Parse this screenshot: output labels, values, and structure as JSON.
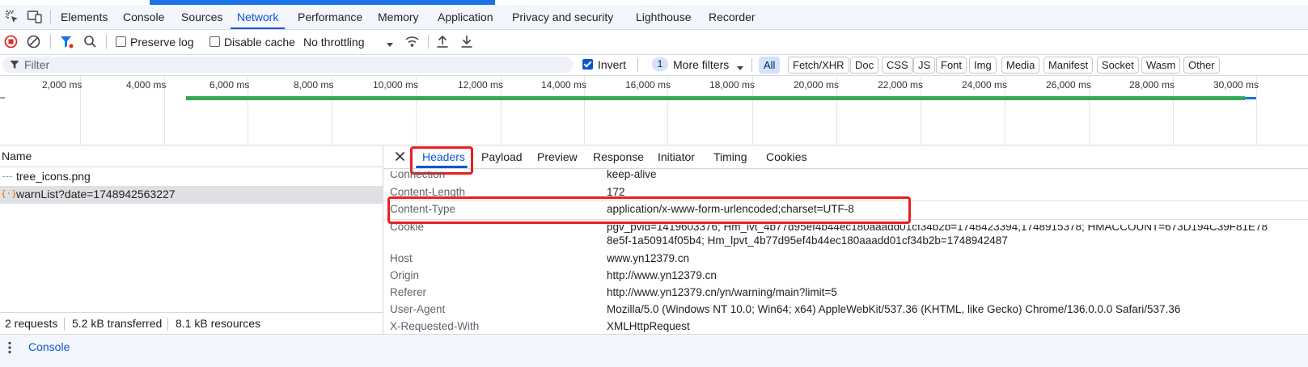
{
  "devtools_tabs": [
    "Elements",
    "Console",
    "Sources",
    "Network",
    "Performance",
    "Memory",
    "Application",
    "Privacy and security",
    "Lighthouse",
    "Recorder"
  ],
  "active_tab": "Network",
  "toolbar": {
    "preserve_log": "Preserve log",
    "disable_cache": "Disable cache",
    "throttling": "No throttling"
  },
  "filter": {
    "placeholder": "Filter",
    "invert_label": "Invert",
    "more_filters_count": "1",
    "more_filters_label": "More filters",
    "types": [
      "All",
      "Fetch/XHR",
      "Doc",
      "CSS",
      "JS",
      "Font",
      "Img",
      "Media",
      "Manifest",
      "Socket",
      "Wasm",
      "Other"
    ],
    "active_type": "All"
  },
  "timeline": {
    "ticks": [
      "2,000 ms",
      "4,000 ms",
      "6,000 ms",
      "8,000 ms",
      "10,000 ms",
      "12,000 ms",
      "14,000 ms",
      "16,000 ms",
      "18,000 ms",
      "20,000 ms",
      "22,000 ms",
      "24,000 ms",
      "26,000 ms",
      "28,000 ms",
      "30,000 ms"
    ],
    "colors": {
      "green": "#34a853",
      "blue": "#1a73e8"
    }
  },
  "requests": {
    "header": "Name",
    "items": [
      {
        "name": "tree_icons.png",
        "selected": false
      },
      {
        "name": "warnList?date=1748942563227",
        "selected": true
      }
    ]
  },
  "status": {
    "requests": "2 requests",
    "transferred": "5.2 kB transferred",
    "resources": "8.1 kB resources"
  },
  "detail_tabs": [
    "Headers",
    "Payload",
    "Preview",
    "Response",
    "Initiator",
    "Timing",
    "Cookies"
  ],
  "detail_active": "Headers",
  "headers": [
    {
      "name": "Connection",
      "value": "keep-alive"
    },
    {
      "name": "Content-Length",
      "value": "172"
    },
    {
      "name": "Content-Type",
      "value": "application/x-www-form-urlencoded;charset=UTF-8"
    },
    {
      "name": "Cookie",
      "value": "pgv_pvid=1419603376; Hm_lvt_4b77d95ef4b44ec180aaadd01cf34b2b=1748423394,1748915378; HMACCOUNT=673D194C39F81E78",
      "value2": "8e5f-1a50914f05b4; Hm_lpvt_4b77d95ef4b44ec180aaadd01cf34b2b=1748942487"
    },
    {
      "name": "Host",
      "value": "www.yn12379.cn"
    },
    {
      "name": "Origin",
      "value": "http://www.yn12379.cn"
    },
    {
      "name": "Referer",
      "value": "http://www.yn12379.cn/yn/warning/main?limit=5"
    },
    {
      "name": "User-Agent",
      "value": "Mozilla/5.0 (Windows NT 10.0; Win64; x64) AppleWebKit/537.36 (KHTML, like Gecko) Chrome/136.0.0.0 Safari/537.36"
    },
    {
      "name": "X-Requested-With",
      "value": "XMLHttpRequest"
    }
  ],
  "drawer": {
    "label": "Console"
  },
  "colors": {
    "accent": "#0b57d0",
    "highlight_box": "#ea1f1f",
    "record_red": "#d93025"
  }
}
